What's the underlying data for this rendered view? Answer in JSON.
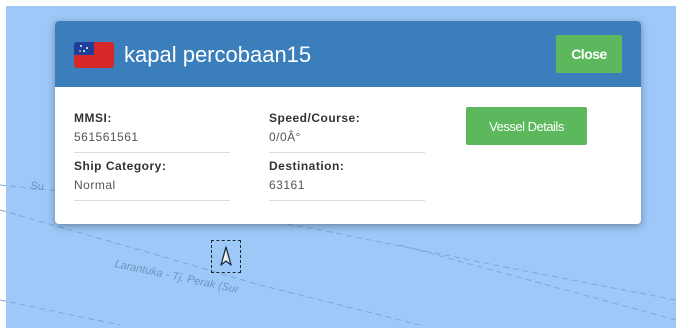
{
  "map": {
    "route_label_main": "Larantuka - Tj. Perak (Sur",
    "route_label_side": "Su",
    "water_color": "#9dc8f8",
    "route_line_color": "#7fa8d8"
  },
  "ship_marker": {
    "icon": "vessel-arrow-icon"
  },
  "popup": {
    "flag_icon": "samoa-flag-icon",
    "vessel_name": "kapal percobaan15",
    "close_label": "Close",
    "details_label": "Vessel Details",
    "header_color": "#3a7ebc",
    "button_color": "#5cb85c",
    "fields": {
      "mmsi": {
        "label": "MMSI:",
        "value": "561561561"
      },
      "speed_course": {
        "label": "Speed/Course:",
        "value": "0/0Â°"
      },
      "ship_category": {
        "label": "Ship Category:",
        "value": "Normal"
      },
      "destination": {
        "label": "Destination:",
        "value": "63161"
      }
    }
  }
}
